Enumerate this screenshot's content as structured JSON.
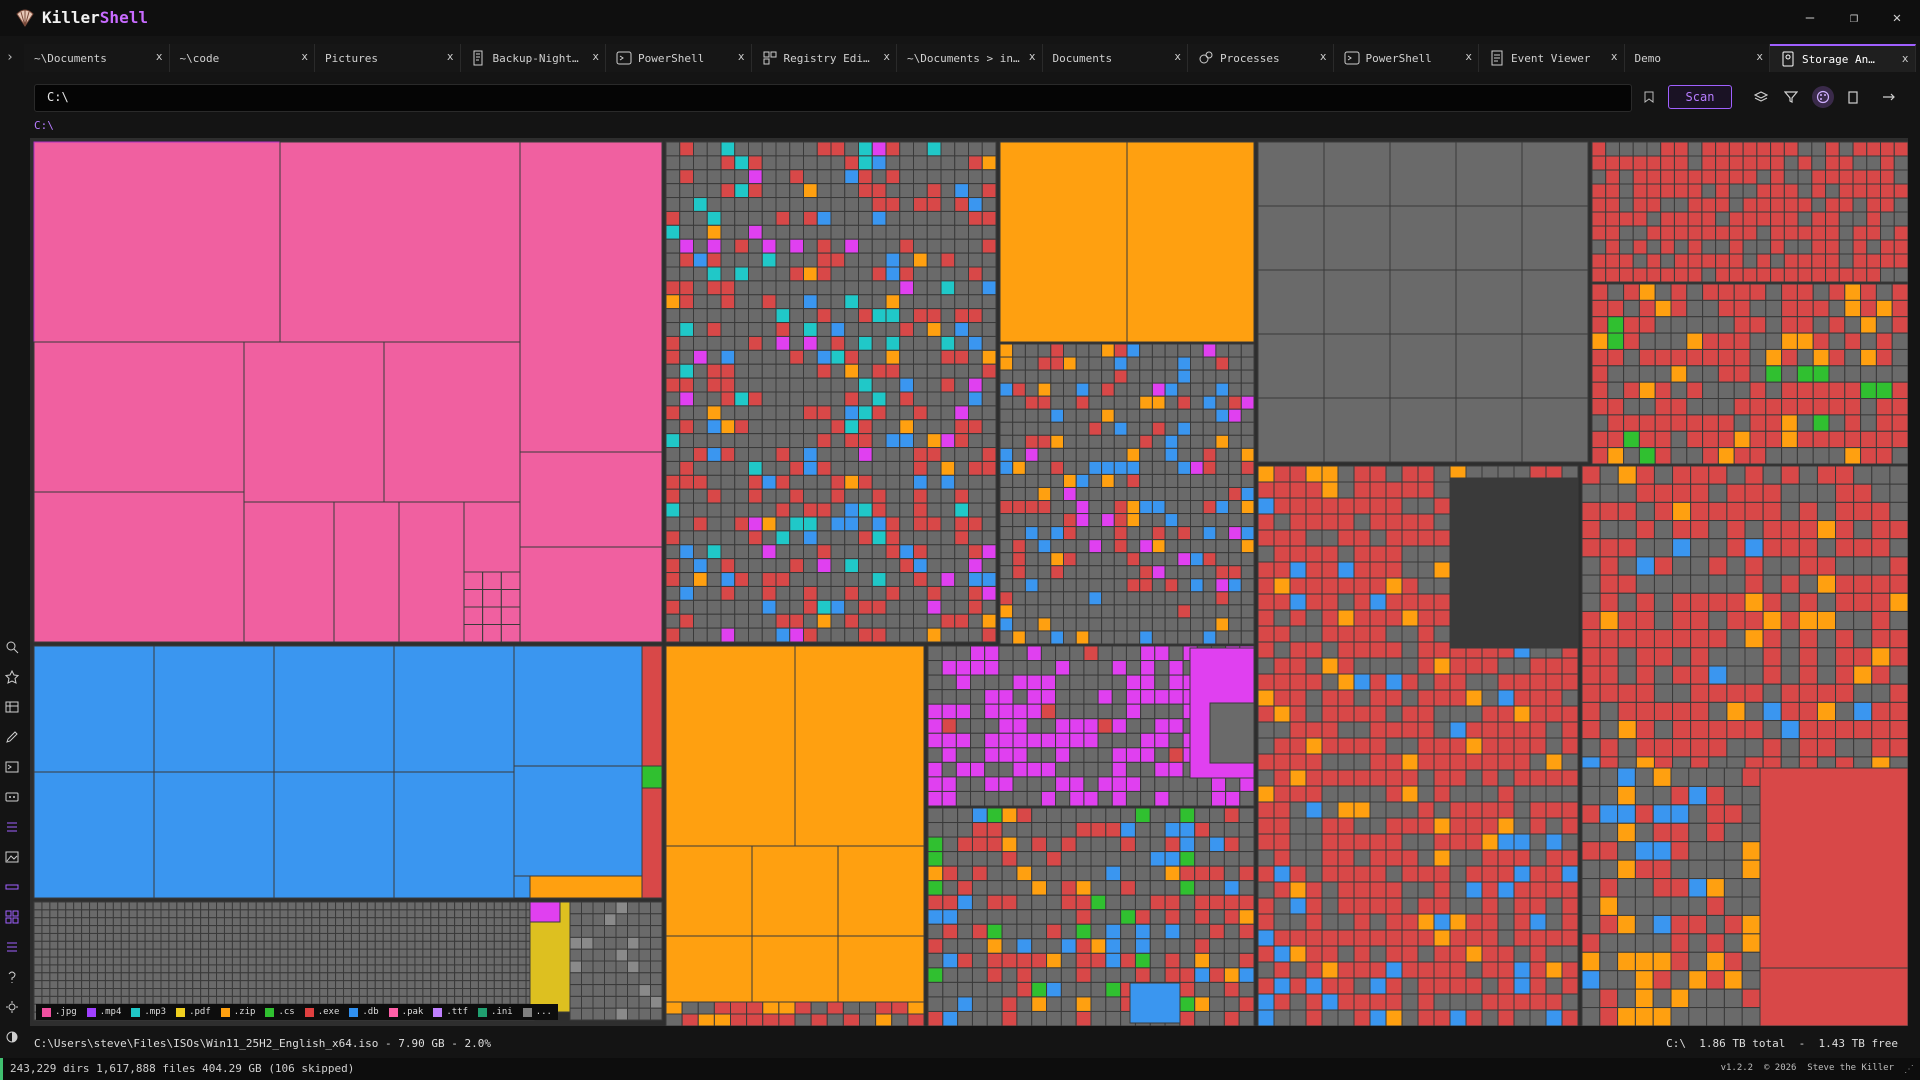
{
  "app": {
    "brand_prefix": "Killer",
    "brand_suffix": "Shell",
    "accent_color": "#a060ff",
    "window_controls": [
      "minimize-icon",
      "restore-icon",
      "close-icon"
    ]
  },
  "tabs": [
    {
      "label": "~\\Documents",
      "icon": null,
      "active": false
    },
    {
      "label": "~\\code",
      "icon": null,
      "active": false
    },
    {
      "label": "Pictures",
      "icon": null,
      "active": false
    },
    {
      "label": "Backup-Night…",
      "icon": "script-icon",
      "active": false
    },
    {
      "label": "PowerShell",
      "icon": "terminal-icon",
      "active": false
    },
    {
      "label": "Registry Edi…",
      "icon": "registry-icon",
      "active": false
    },
    {
      "label": "~\\Documents > in…",
      "icon": null,
      "active": false
    },
    {
      "label": "Documents",
      "icon": null,
      "active": false
    },
    {
      "label": "Processes",
      "icon": "cogs-icon",
      "active": false
    },
    {
      "label": "PowerShell",
      "icon": "terminal-icon",
      "active": false
    },
    {
      "label": "Event Viewer",
      "icon": "event-log-icon",
      "active": false
    },
    {
      "label": "Demo",
      "icon": null,
      "active": false
    },
    {
      "label": "Storage An…",
      "icon": "storage-icon",
      "active": true
    }
  ],
  "tab_close_glyph": "x",
  "address_bar": {
    "value": "C:\\"
  },
  "toolbar": {
    "scan_label": "Scan",
    "icons": [
      "bookmark-icon",
      "layers-icon",
      "filter-icon",
      "palette-icon",
      "copy-icon",
      "arrow-right-icon"
    ]
  },
  "breadcrumb": "C:\\",
  "legend": [
    {
      "label": ".jpg",
      "color": "#f050a0"
    },
    {
      "label": ".mp4",
      "color": "#a040ff"
    },
    {
      "label": ".mp3",
      "color": "#20c8c8"
    },
    {
      "label": ".pdf",
      "color": "#f0d020"
    },
    {
      "label": ".zip",
      "color": "#ffa010"
    },
    {
      "label": ".cs",
      "color": "#30c030"
    },
    {
      "label": ".exe",
      "color": "#e04040"
    },
    {
      "label": ".db",
      "color": "#3090f0"
    },
    {
      "label": ".pak",
      "color": "#ff60a8"
    },
    {
      "label": ".ttf",
      "color": "#c080ff"
    },
    {
      "label": ".ini",
      "color": "#20a070"
    },
    {
      "label": "...",
      "color": "#808080"
    }
  ],
  "selection_info": {
    "path": "C:\\Users\\steve\\Files\\ISOs\\Win11_25H2_English_x64.iso",
    "size": "7.90 GB",
    "percent": "2.0%",
    "drive": "C:\\",
    "total": "1.86 TB total",
    "free": "1.43 TB free"
  },
  "status": {
    "dirs": "243,229 dirs",
    "files": "1,617,888 files",
    "size": "404.29 GB",
    "skipped": "(106 skipped)",
    "version": "v1.2.2",
    "copyright": "© 2026",
    "author": "Steve the Killer"
  },
  "sidebar_icons": [
    "search-icon",
    "star-icon",
    "table-icon",
    "edit-icon",
    "terminal-panel-icon",
    "keyboard-icon",
    "list-icon",
    "image-icon",
    "ruler-icon",
    "grid-icon",
    "tasks-icon",
    "help-icon",
    "settings-icon",
    "theme-icon"
  ],
  "colors": {
    "jpg": "#f060a0",
    "db": "#3a96f0",
    "zip": "#ffa010",
    "exe": "#d84848",
    "mp4": "#e040f0",
    "other": "#6a6a6a"
  }
}
